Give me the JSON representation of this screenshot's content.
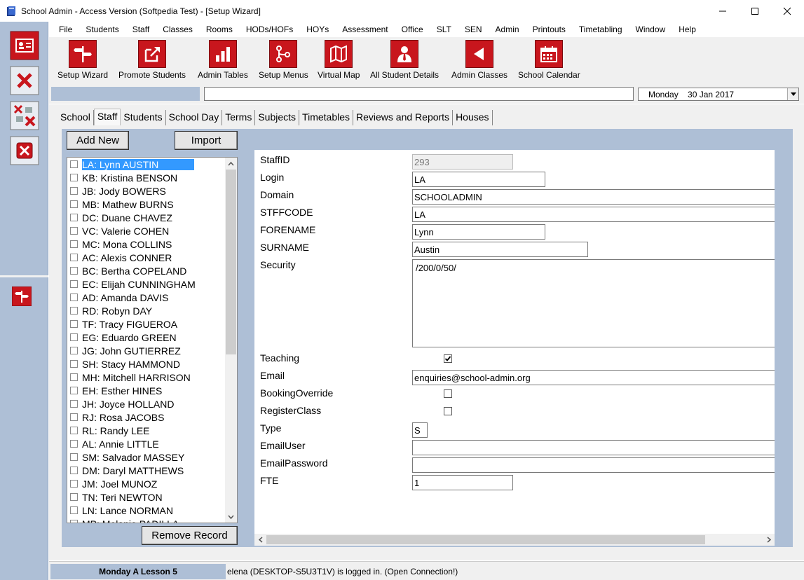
{
  "window": {
    "title": "School Admin - Access Version (Softpedia Test) - [Setup Wizard]"
  },
  "menu": [
    "File",
    "Students",
    "Staff",
    "Classes",
    "Rooms",
    "HODs/HOFs",
    "HOYs",
    "Assessment",
    "Office",
    "SLT",
    "SEN",
    "Admin",
    "Printouts",
    "Timetabling",
    "Window",
    "Help"
  ],
  "toolbar": [
    {
      "label": "Setup Wizard",
      "icon": "signpost-icon"
    },
    {
      "label": "Promote Students",
      "icon": "share-arrow-icon"
    },
    {
      "label": "Admin Tables",
      "icon": "bar-chart-icon"
    },
    {
      "label": "Setup Menus",
      "icon": "branch-icon"
    },
    {
      "label": "Virtual Map",
      "icon": "map-icon"
    },
    {
      "label": "All Student Details",
      "icon": "person-icon"
    },
    {
      "label": "Admin Classes",
      "icon": "back-arrow-icon"
    },
    {
      "label": "School Calendar",
      "icon": "calendar-icon"
    }
  ],
  "date_picker": {
    "value": "Monday    30 Jan 2017"
  },
  "tabs": [
    "School",
    "Staff",
    "Students",
    "School Day",
    "Terms",
    "Subjects",
    "Timetables",
    "Reviews and Reports",
    "Houses"
  ],
  "active_tab": "Staff",
  "buttons": {
    "add_new": "Add New",
    "import": "Import",
    "remove_record": "Remove Record"
  },
  "staff_list": [
    "LA: Lynn AUSTIN",
    "KB: Kristina BENSON",
    "JB: Jody BOWERS",
    "MB: Mathew BURNS",
    "DC: Duane CHAVEZ",
    "VC: Valerie COHEN",
    "MC: Mona COLLINS",
    "AC: Alexis CONNER",
    "BC: Bertha COPELAND",
    "EC: Elijah CUNNINGHAM",
    "AD: Amanda DAVIS",
    "RD: Robyn DAY",
    "TF: Tracy FIGUEROA",
    "EG: Eduardo GREEN",
    "JG: John GUTIERREZ",
    "SH: Stacy HAMMOND",
    "MH: Mitchell HARRISON",
    "EH: Esther HINES",
    "JH: Joyce HOLLAND",
    "RJ: Rosa JACOBS",
    "RL: Randy LEE",
    "AL: Annie LITTLE",
    "SM: Salvador MASSEY",
    "DM: Daryl MATTHEWS",
    "JM: Joel MUNOZ",
    "TN: Teri NEWTON",
    "LN: Lance NORMAN",
    "MP: Melanie PADILLA"
  ],
  "form": {
    "staffid": {
      "label": "StaffID",
      "value": "293"
    },
    "login": {
      "label": "Login",
      "value": "LA"
    },
    "domain": {
      "label": "Domain",
      "value": "SCHOOLADMIN"
    },
    "stffcode": {
      "label": "STFFCODE",
      "value": "LA"
    },
    "forename": {
      "label": "FORENAME",
      "value": "Lynn"
    },
    "surname": {
      "label": "SURNAME",
      "value": "Austin"
    },
    "security": {
      "label": "Security",
      "value": "/200/0/50/"
    },
    "teaching": {
      "label": "Teaching",
      "checked": true
    },
    "email": {
      "label": "Email",
      "value": "enquiries@school-admin.org"
    },
    "bookingoverride": {
      "label": "BookingOverride",
      "checked": false
    },
    "registerclass": {
      "label": "RegisterClass",
      "checked": false
    },
    "type": {
      "label": "Type",
      "value": "S"
    },
    "emailuser": {
      "label": "EmailUser",
      "value": ""
    },
    "emailpassword": {
      "label": "EmailPassword",
      "value": ""
    },
    "fte": {
      "label": "FTE",
      "value": "1"
    }
  },
  "status": {
    "lesson": "Monday A Lesson 5",
    "message": "elena (DESKTOP-S5U3T1V) is logged in. (Open Connection!)"
  },
  "colors": {
    "accent_red": "#c8161d",
    "panel_blue": "#aebfd6",
    "selection": "#3399ff"
  }
}
